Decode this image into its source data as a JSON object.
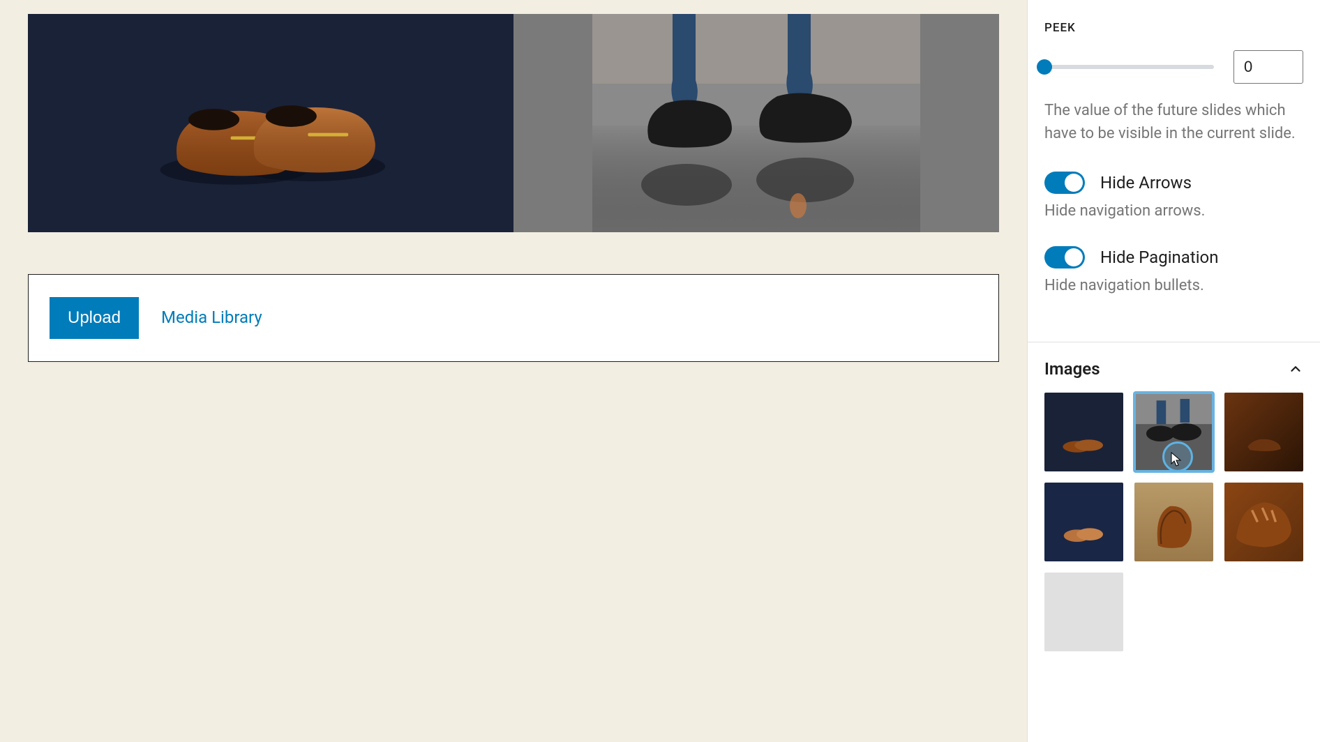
{
  "sidebar": {
    "peek": {
      "label": "PEEK",
      "value": "0",
      "description": "The value of the future slides which have to be visible in the current slide."
    },
    "hide_arrows": {
      "label": "Hide Arrows",
      "description": "Hide navigation arrows.",
      "enabled": true
    },
    "hide_pagination": {
      "label": "Hide Pagination",
      "description": "Hide navigation bullets.",
      "enabled": true
    },
    "images_section": {
      "title": "Images"
    }
  },
  "upload_panel": {
    "upload_label": "Upload",
    "media_library_label": "Media Library"
  }
}
